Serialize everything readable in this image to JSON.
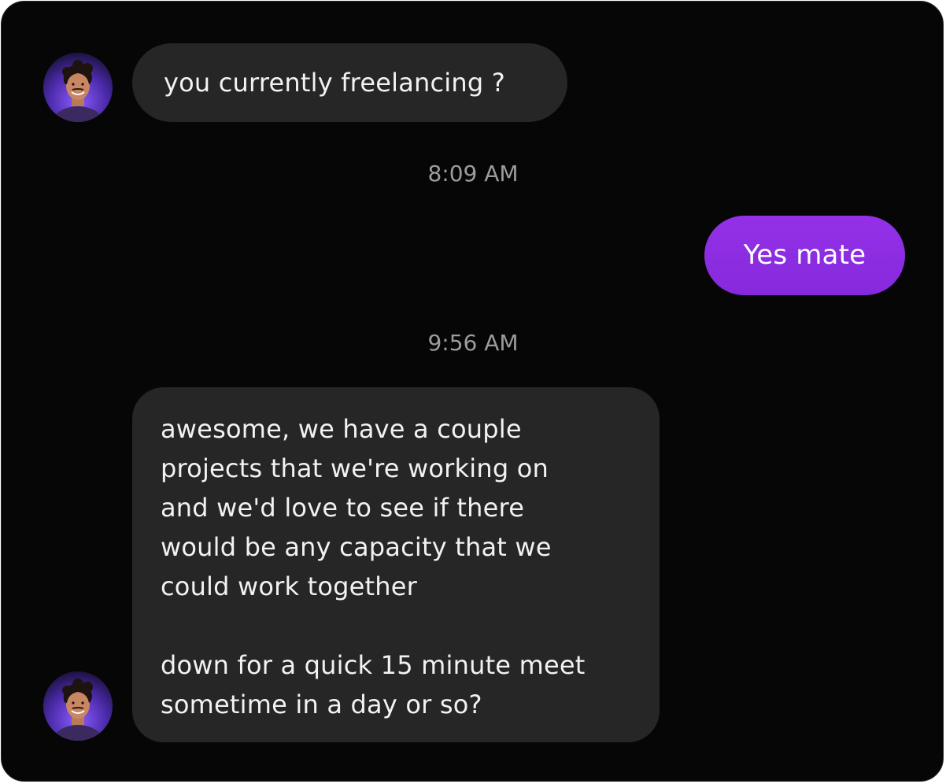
{
  "conversation": {
    "messages": [
      {
        "direction": "incoming",
        "text": "you currently freelancing ?"
      },
      {
        "direction": "outgoing",
        "text": "Yes mate"
      },
      {
        "direction": "incoming",
        "paragraphs": [
          "awesome, we have a couple\nprojects that we're working on\nand we'd love to see if there\nwould be any capacity that we\ncould work together",
          "down for a quick 15 minute meet\nsometime in a day or so?"
        ]
      }
    ],
    "timestamps": [
      "8:09 AM",
      "9:56 AM"
    ]
  },
  "avatar_icon": "person-photo-avatar-icon",
  "colors": {
    "background": "#060606",
    "incoming_bubble": "#262626",
    "outgoing_bubble": "#8A2BE2",
    "timestamp_text": "#9C9C9C"
  }
}
